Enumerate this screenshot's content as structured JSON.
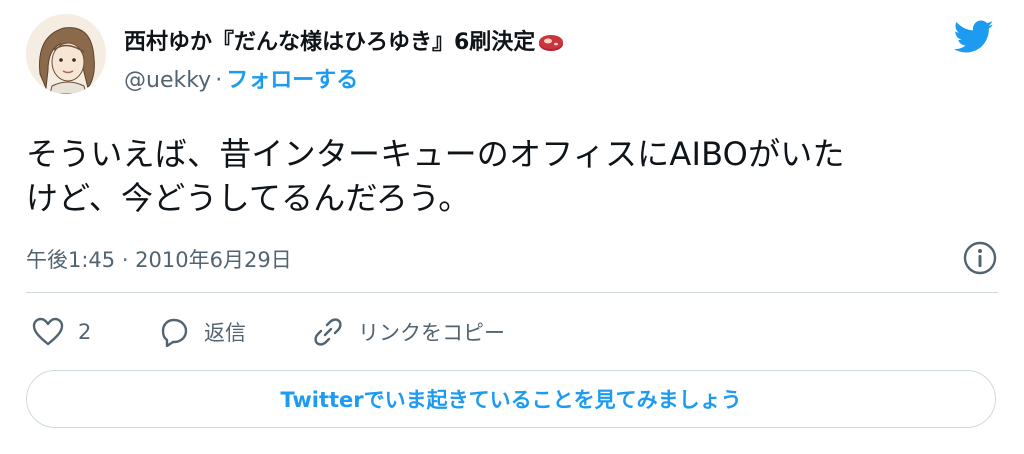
{
  "author": {
    "name": "西村ゆか『だんな様はひろゆき』6刷決定",
    "handle": "@uekky",
    "separator": "·",
    "follow_label": "フォローする"
  },
  "tweet": {
    "text_line1": "そういえば、昔インターキューのオフィスにAIBOがいた",
    "text_line2": "けど、今どうしてるんだろう。",
    "timestamp": "午後1:45 · 2010年6月29日"
  },
  "actions": {
    "like_count": "2",
    "reply_label": "返信",
    "copy_link_label": "リンクをコピー"
  },
  "cta": {
    "label": "Twitterでいま起きていることを見てみましょう"
  },
  "colors": {
    "accent": "#1d9bf0",
    "text": "#0f1419",
    "muted": "#536471",
    "border": "#cfd9de"
  },
  "icons": [
    "avatar-illustration",
    "steak-emoji",
    "twitter-bird-icon",
    "info-icon",
    "heart-icon",
    "reply-icon",
    "link-icon"
  ]
}
